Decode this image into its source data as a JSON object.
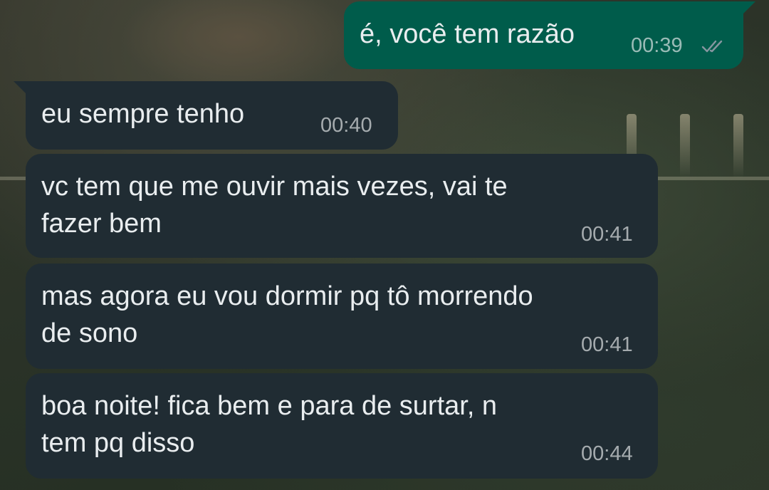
{
  "messages": [
    {
      "direction": "outgoing",
      "text": "é, você tem razão",
      "time": "00:39",
      "status_icon": "double-check-icon"
    },
    {
      "direction": "incoming",
      "text": "eu sempre tenho",
      "time": "00:40"
    },
    {
      "direction": "incoming",
      "text": "vc tem que me ouvir mais vezes, vai te\nfazer bem",
      "time": "00:41"
    },
    {
      "direction": "incoming",
      "text": "mas agora eu vou dormir pq tô morrendo\nde sono",
      "time": "00:41"
    },
    {
      "direction": "incoming",
      "text": "boa noite! fica bem e para de surtar, n\ntem pq disso",
      "time": "00:44"
    }
  ],
  "colors": {
    "incoming_bubble": "#202c33",
    "outgoing_bubble": "#005c4b",
    "text": "#e9edef",
    "ticks": "#8696a0"
  }
}
